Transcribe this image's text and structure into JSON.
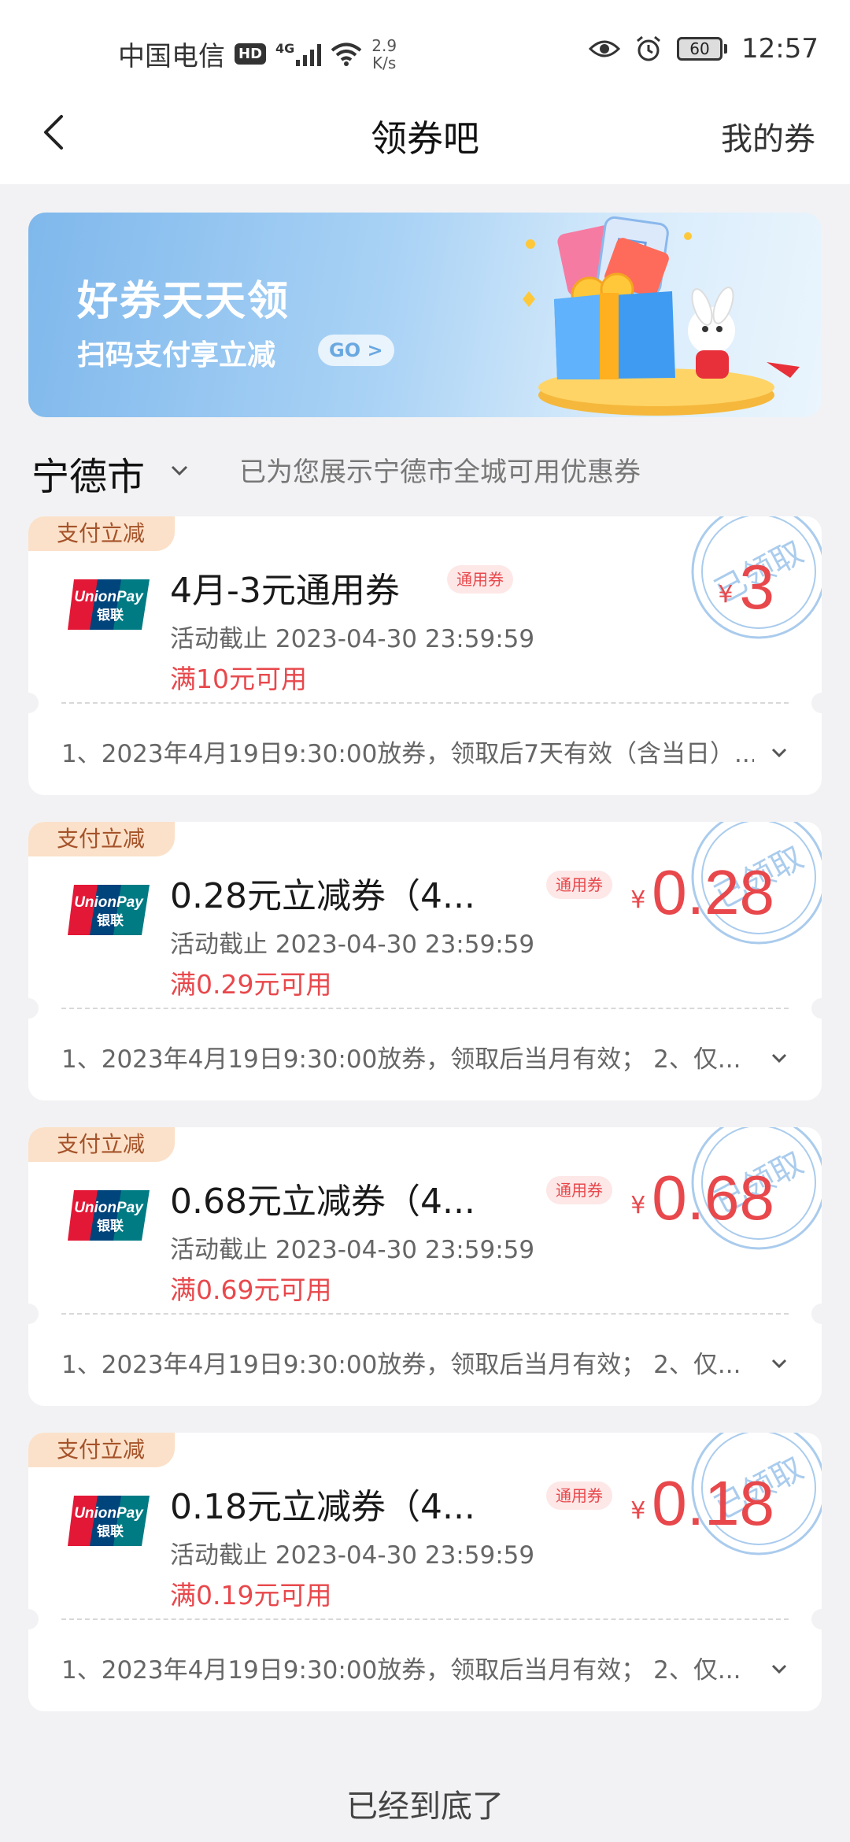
{
  "status_bar": {
    "carrier": "中国电信",
    "hd": "HD",
    "net_type": "4G",
    "net_speed_value": "2.9",
    "net_speed_unit": "K/s",
    "battery": "60",
    "time": "12:57"
  },
  "nav": {
    "title": "领券吧",
    "my_coupons": "我的券"
  },
  "banner": {
    "title": "好券天天领",
    "subtitle": "扫码支付享立减",
    "go": "GO >"
  },
  "city": {
    "name": "宁德市",
    "hint": "已为您展示宁德市全城可用优惠券"
  },
  "coupons": [
    {
      "tag": "支付立减",
      "title": "4月-3元通用券",
      "badge": "通用券",
      "deadline": "活动截止 2023-04-30 23:59:59",
      "threshold": "满10元可用",
      "currency": "¥",
      "amount": "3",
      "stamp": "已领取",
      "rule": "1、2023年4月19日9:30:00放券，领取后7天有效（含当日）..."
    },
    {
      "tag": "支付立减",
      "title": "0.28元立减券（4...",
      "badge": "通用券",
      "deadline": "活动截止 2023-04-30 23:59:59",
      "threshold": "满0.29元可用",
      "currency": "¥",
      "amount": "0.28",
      "stamp": "已领取",
      "rule": "1、2023年4月19日9:30:00放券，领取后当月有效； 2、仅..."
    },
    {
      "tag": "支付立减",
      "title": "0.68元立减券（4...",
      "badge": "通用券",
      "deadline": "活动截止 2023-04-30 23:59:59",
      "threshold": "满0.69元可用",
      "currency": "¥",
      "amount": "0.68",
      "stamp": "已领取",
      "rule": "1、2023年4月19日9:30:00放券，领取后当月有效； 2、仅..."
    },
    {
      "tag": "支付立减",
      "title": "0.18元立减券（4...",
      "badge": "通用券",
      "deadline": "活动截止 2023-04-30 23:59:59",
      "threshold": "满0.19元可用",
      "currency": "¥",
      "amount": "0.18",
      "stamp": "已领取",
      "rule": "1、2023年4月19日9:30:00放券，领取后当月有效； 2、仅..."
    }
  ],
  "footer": {
    "end_text": "已经到底了"
  },
  "colors": {
    "accent_red": "#e8484c",
    "tag_bg": "#fbe1c9",
    "stamp_blue": "#9cc3ea",
    "page_bg": "#f2f2f4"
  }
}
